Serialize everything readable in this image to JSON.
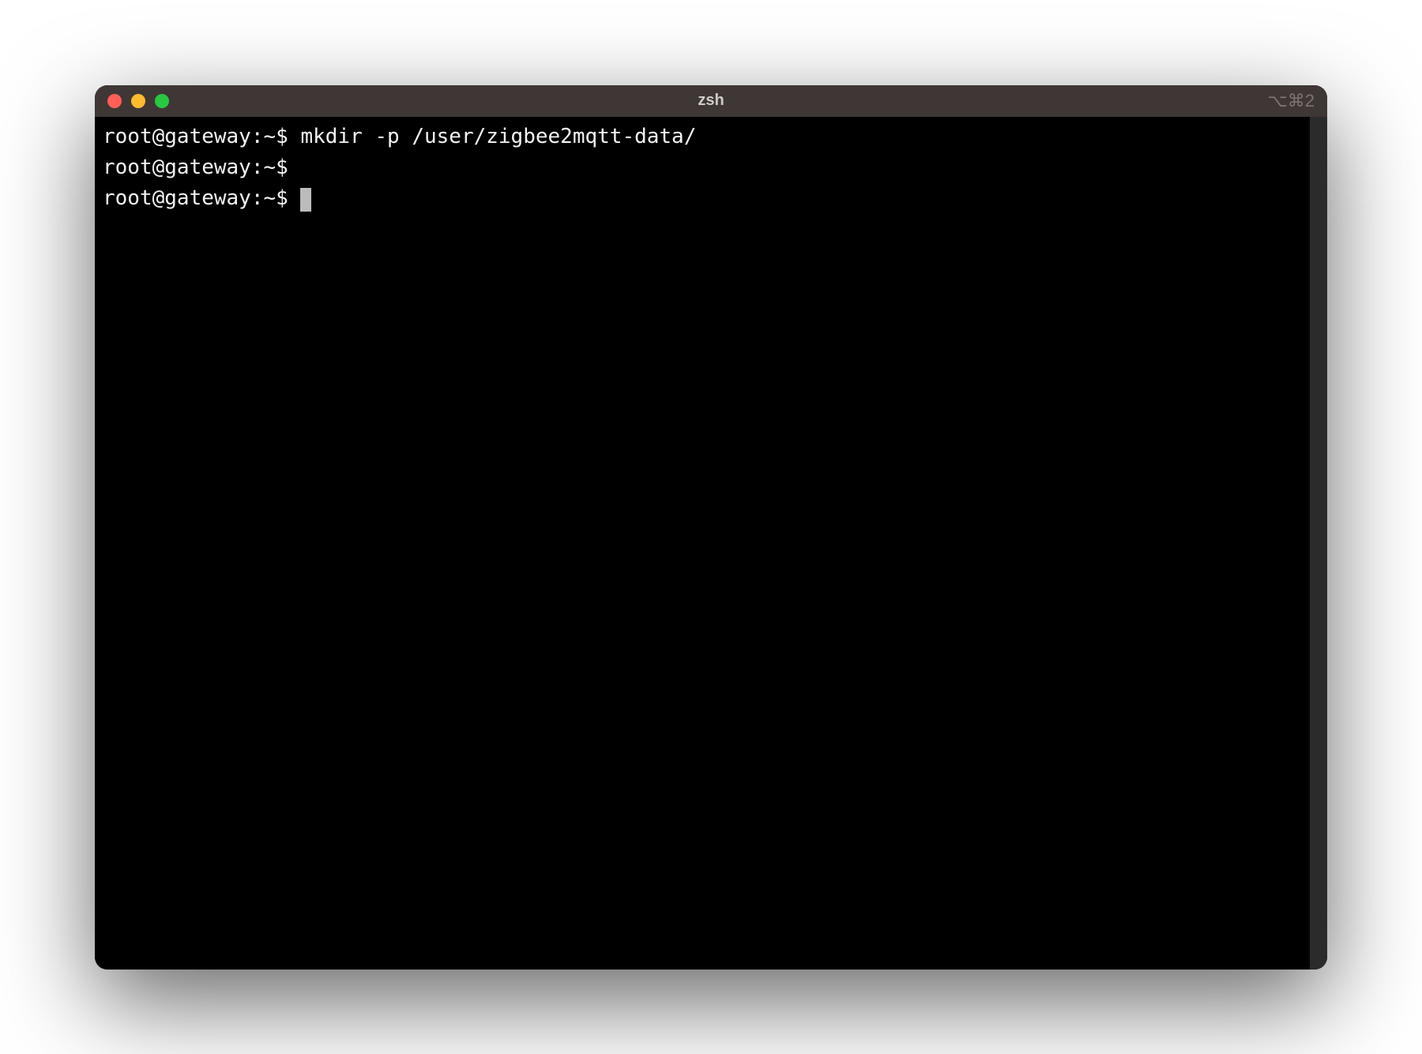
{
  "window": {
    "title": "zsh",
    "tabIndicator": "⌥⌘2"
  },
  "terminal": {
    "lines": [
      {
        "prompt": "root@gateway:~$ ",
        "command": "mkdir -p /user/zigbee2mqtt-data/"
      },
      {
        "prompt": "root@gateway:~$ ",
        "command": ""
      },
      {
        "prompt": "root@gateway:~$ ",
        "command": "",
        "cursor": true
      }
    ]
  }
}
